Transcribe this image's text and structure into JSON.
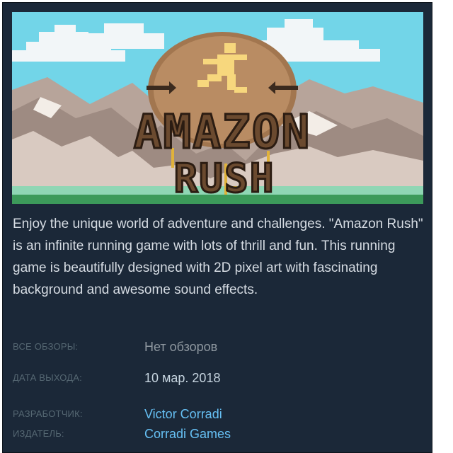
{
  "capsule": {
    "title_line1": "AMAZON",
    "title_line2": "RUSH"
  },
  "description": "Enjoy the unique world of adventure and challenges. \"Amazon Rush\" is an infinite running game with lots of thrill and fun. This running game is beautifully designed with 2D pixel art with fascinating background and awesome sound effects.",
  "meta": {
    "reviews_label": "ВСЕ ОБЗОРЫ:",
    "reviews_value": "Нет обзоров",
    "release_label": "ДАТА ВЫХОДА:",
    "release_value": "10 мар. 2018",
    "developer_label": "РАЗРАБОТЧИК:",
    "developer_value": "Victor Corradi",
    "publisher_label": "ИЗДАТЕЛЬ:",
    "publisher_value": "Corradi Games"
  },
  "colors": {
    "panel_bg": "#1b2838",
    "link": "#66c0f4",
    "label": "#556772",
    "text": "#d6dce3"
  }
}
